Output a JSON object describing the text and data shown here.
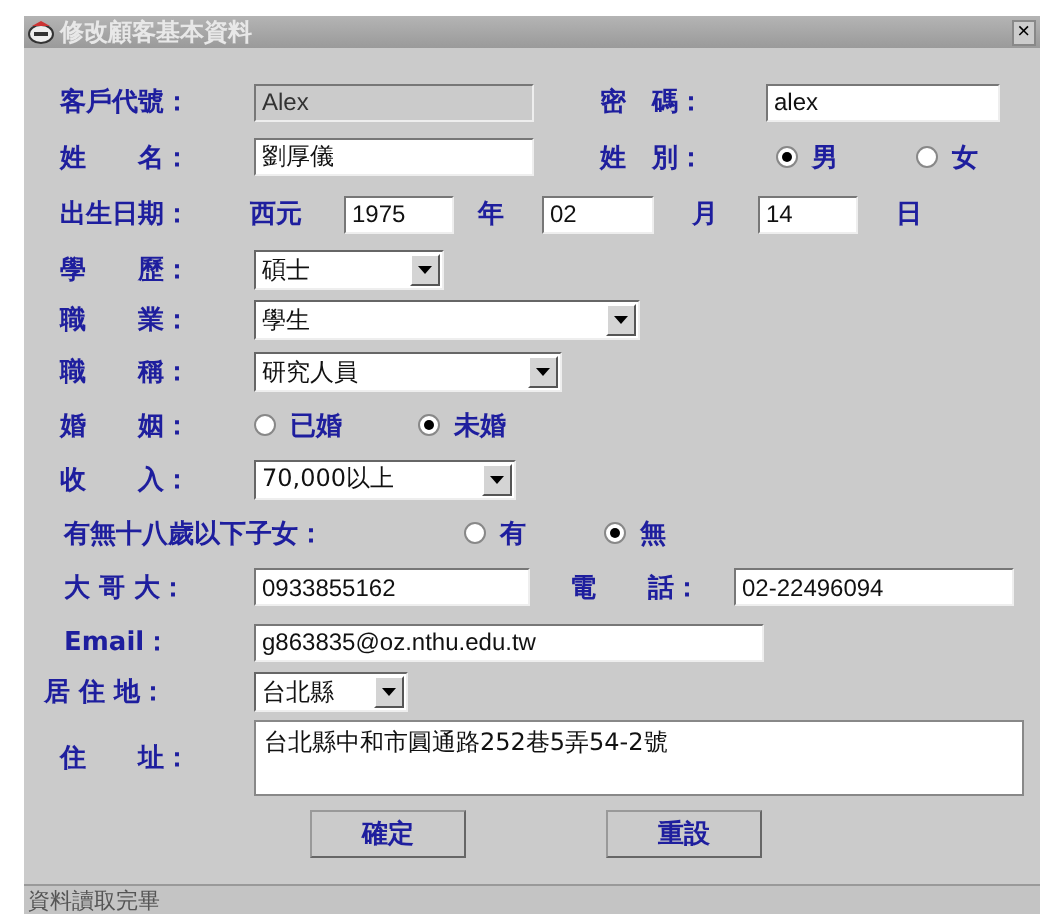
{
  "window": {
    "title": "修改顧客基本資料",
    "close": "×"
  },
  "rows": [
    {
      "items": [
        {
          "kind": "label",
          "text": "客戶代號："
        },
        {
          "kind": "field",
          "value": "Alex",
          "disabled": true
        },
        {
          "kind": "label",
          "text": "密　碼："
        },
        {
          "kind": "field",
          "value": "alex",
          "disabled": false
        }
      ]
    },
    {
      "items": [
        {
          "kind": "label",
          "text": "姓　　名："
        },
        {
          "kind": "field",
          "value": "劉厚儀",
          "disabled": false
        },
        {
          "kind": "label",
          "text": "姓　別："
        },
        {
          "kind": "radio",
          "text": "男",
          "selected": true
        },
        {
          "kind": "radio",
          "text": "女",
          "selected": false
        }
      ]
    },
    {
      "items": [
        {
          "kind": "label",
          "text": "出生日期："
        },
        {
          "kind": "label",
          "text": "西元"
        },
        {
          "kind": "field",
          "value": "1975",
          "disabled": false
        },
        {
          "kind": "label",
          "text": "年"
        },
        {
          "kind": "field",
          "value": "02",
          "disabled": false
        },
        {
          "kind": "label",
          "text": "月"
        },
        {
          "kind": "field",
          "value": "14",
          "disabled": false
        },
        {
          "kind": "label",
          "text": "日"
        }
      ]
    },
    {
      "items": [
        {
          "kind": "label",
          "text": "學　　歷："
        },
        {
          "kind": "combo",
          "value": "碩士"
        }
      ]
    },
    {
      "items": [
        {
          "kind": "label",
          "text": "職　　業："
        },
        {
          "kind": "combo",
          "value": "學生"
        }
      ]
    },
    {
      "items": [
        {
          "kind": "label",
          "text": "職　　稱："
        },
        {
          "kind": "combo",
          "value": "研究人員"
        }
      ]
    },
    {
      "items": [
        {
          "kind": "label",
          "text": "婚　　姻："
        },
        {
          "kind": "radio",
          "text": "已婚",
          "selected": false
        },
        {
          "kind": "radio",
          "text": "未婚",
          "selected": true
        }
      ]
    },
    {
      "items": [
        {
          "kind": "label",
          "text": "收　　入："
        },
        {
          "kind": "combo",
          "value": "70,000以上"
        }
      ]
    },
    {
      "items": [
        {
          "kind": "label",
          "text": "有無十八歲以下子女："
        },
        {
          "kind": "radio",
          "text": "有",
          "selected": false
        },
        {
          "kind": "radio",
          "text": "無",
          "selected": true
        }
      ]
    },
    {
      "items": [
        {
          "kind": "label",
          "text": "大 哥 大："
        },
        {
          "kind": "field",
          "value": "0933855162",
          "disabled": false
        },
        {
          "kind": "label",
          "text": "電　　話："
        },
        {
          "kind": "field",
          "value": "02-22496094",
          "disabled": false
        }
      ]
    },
    {
      "items": [
        {
          "kind": "label",
          "text": "Email："
        },
        {
          "kind": "field",
          "value": "g863835@oz.nthu.edu.tw",
          "disabled": false
        }
      ]
    },
    {
      "items": [
        {
          "kind": "label",
          "text": "居 住 地："
        },
        {
          "kind": "combo",
          "value": "台北縣"
        }
      ]
    },
    {
      "items": [
        {
          "kind": "label",
          "text": "住　　址："
        },
        {
          "kind": "textarea",
          "value": "台北縣中和市圓通路252巷5弄54-2號"
        }
      ]
    }
  ],
  "buttons": [
    "確定",
    "重設"
  ],
  "status_bar": "資料讀取完畢"
}
